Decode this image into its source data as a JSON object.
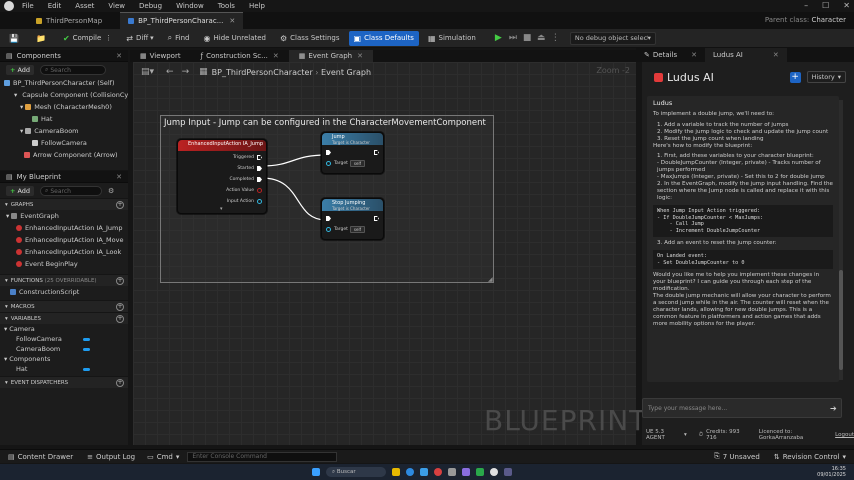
{
  "menu": {
    "items": [
      "File",
      "Edit",
      "Asset",
      "View",
      "Debug",
      "Window",
      "Tools",
      "Help"
    ]
  },
  "doc_tabs": [
    {
      "label": "ThirdPersonMap"
    },
    {
      "label": "BP_ThirdPersonCharac..."
    }
  ],
  "parent_class": {
    "label": "Parent class:",
    "value": "Character"
  },
  "toolbar": {
    "compile": "Compile",
    "diff": "Diff",
    "find": "Find",
    "hide_unrelated": "Hide Unrelated",
    "class_settings": "Class Settings",
    "class_defaults": "Class Defaults",
    "simulation": "Simulation",
    "debug_object": "No debug object selected"
  },
  "components": {
    "tab": "Components",
    "add": "Add",
    "search_placeholder": "Search",
    "tree": [
      "BP_ThirdPersonCharacter (Self)",
      "Capsule Component (CollisionCylinder)",
      "Mesh (CharacterMesh0)",
      "Hat",
      "CameraBoom",
      "FollowCamera",
      "Arrow Component (Arrow)"
    ]
  },
  "myblueprint": {
    "tab": "My Blueprint",
    "add": "Add",
    "search_placeholder": "Search",
    "graphs_header": "GRAPHS",
    "event_graph": "EventGraph",
    "events": [
      "EnhancedInputAction IA_Jump",
      "EnhancedInputAction IA_Move",
      "EnhancedInputAction IA_Look",
      "Event BeginPlay"
    ],
    "functions_header": "FUNCTIONS",
    "functions_override": "(25 OVERRIDABLE)",
    "construction_script": "ConstructionScript",
    "macros_header": "MACROS",
    "variables_header": "VARIABLES",
    "var_camera": "Camera",
    "var_follow": "FollowCamera",
    "var_boom": "CameraBoom",
    "var_components": "Components",
    "var_hat": "Hat",
    "dispatchers_header": "EVENT DISPATCHERS"
  },
  "center_tabs": [
    {
      "label": "Viewport"
    },
    {
      "label": "Construction Sc..."
    },
    {
      "label": "Event Graph"
    }
  ],
  "graph": {
    "breadcrumb_root": "BP_ThirdPersonCharacter",
    "breadcrumb_leaf": "Event Graph",
    "zoom": "Zoom -2",
    "comment": "Jump Input - Jump can be configured in the CharacterMovementComponent",
    "input_node": {
      "title": "EnhancedInputAction IA_Jump",
      "pins": [
        "Triggered",
        "Started",
        "Completed",
        "Action Value",
        "Input Action"
      ]
    },
    "jump_node": {
      "title": "Jump",
      "subtitle": "Target is Character",
      "target": "Target",
      "self": "self"
    },
    "stop_node": {
      "title": "Stop Jumping",
      "subtitle": "Target is Character",
      "target": "Target",
      "self": "self"
    },
    "watermark": "BLUEPRINT"
  },
  "right_tabs": [
    {
      "label": "Details"
    },
    {
      "label": "Ludus AI"
    }
  ],
  "ludus": {
    "title": "Ludus AI",
    "history": "History",
    "sender": "Ludus",
    "intro": "To implement a double jump, we'll need to:",
    "steps": [
      "1. Add a variable to track the number of jumps",
      "2. Modify the jump logic to check and update the jump count",
      "3. Reset the jump count when landing"
    ],
    "how": "Here's how to modify the blueprint:",
    "first": "1. First, add these variables to your character blueprint:",
    "vars": [
      "- DoubleJumpCounter (Integer, private) - Tracks number of jumps performed",
      "- MaxJumps (Integer, private) - Set this to 2 for double jump"
    ],
    "second": "2. In the EventGraph, modify the jump input handling. Find the section where the Jump node is called and replace it with this logic:",
    "code1": "When Jump Input Action triggered:\n- If DoubleJumpCounter < MaxJumps:\n    - Call Jump\n    - Increment DoubleJumpCounter",
    "third": "3. Add an event to reset the jump counter:",
    "code2": "On Landed event:\n- Set DoubleJumpCounter to 0",
    "outro": "Would you like me to help you implement these changes in your blueprint? I can guide you through each step of the modification.",
    "summary": "The double jump mechanic will allow your character to perform a second jump while in the air. The counter will reset when the character lands, allowing for new double jumps. This is a common feature in platformers and action games that adds more mobility options for the player.",
    "placeholder": "Type your message here...",
    "version": "UE 5.3 AGENT",
    "credits": "Credits: 993 716",
    "licence": "Licenced to: GorkaArranzaba",
    "logout": "Logout"
  },
  "bottom": {
    "content_drawer": "Content Drawer",
    "output_log": "Output Log",
    "cmd": "Cmd",
    "console_placeholder": "Enter Console Command",
    "unsaved": "7 Unsaved",
    "revision": "Revision Control"
  },
  "taskbar": {
    "search": "Buscar",
    "time": "16:35",
    "date": "09/01/2025"
  }
}
